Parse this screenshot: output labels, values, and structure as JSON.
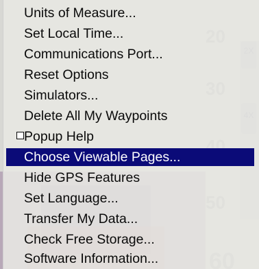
{
  "menu": {
    "items": [
      {
        "label": "Units of Measure..."
      },
      {
        "label": "Set Local Time..."
      },
      {
        "label": "Communications Port..."
      },
      {
        "label": "Reset Options"
      },
      {
        "label": "Simulators..."
      },
      {
        "label": "Delete All My Waypoints"
      },
      {
        "label": "Popup Help",
        "checkbox": true,
        "checked": false
      },
      {
        "label": "Choose Viewable Pages...",
        "selected": true
      },
      {
        "label": "Hide GPS Features"
      },
      {
        "label": "Set Language..."
      },
      {
        "label": "Transfer My Data..."
      },
      {
        "label": "Check Free Storage..."
      },
      {
        "label": "Software Information..."
      }
    ]
  },
  "background": {
    "depth_scale": [
      "20",
      "30",
      "40",
      "50",
      "60"
    ],
    "zoom_badges": [
      "2X",
      "4X"
    ]
  },
  "colors": {
    "menu_bg": "#e7e7e2",
    "selected_bg": "#0b0b78",
    "selected_text": "#ffffff",
    "text": "#0a0a0a"
  }
}
